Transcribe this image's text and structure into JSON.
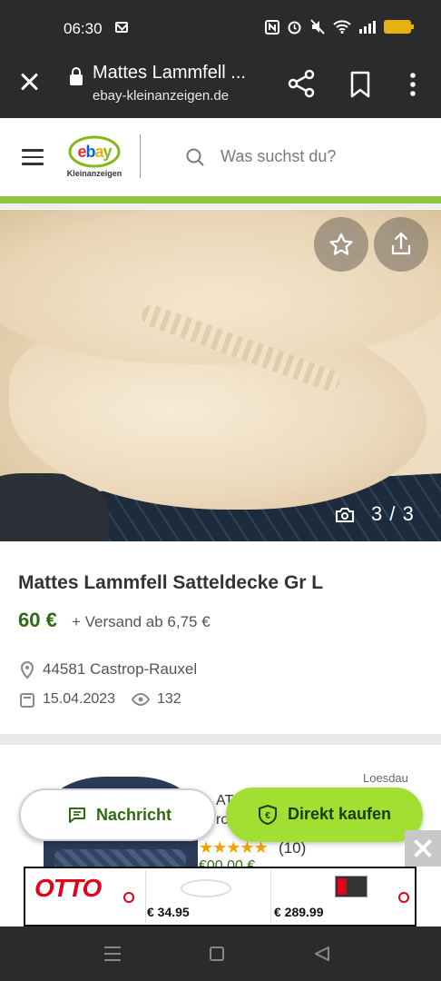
{
  "status_bar": {
    "time": "06:30"
  },
  "browser": {
    "tab_title": "Mattes Lammfell ...",
    "url": "ebay-kleinanzeigen.de"
  },
  "site_header": {
    "logo_text": "ebay",
    "logo_subtext": "Kleinanzeigen",
    "search_placeholder": "Was suchst du?"
  },
  "gallery": {
    "counter": "3 / 3"
  },
  "ad": {
    "title": "Mattes Lammfell Satteldecke Gr L",
    "price": "60 €",
    "shipping": "+ Versand ab 6,75 €",
    "location": "44581 Castrop-Rauxel",
    "date": "15.04.2023",
    "views": "132"
  },
  "promo": {
    "source": "Loesdau",
    "text_line1": "AT",
    "text_line2": "ro",
    "stars": "★★★★★",
    "rating_count": "(10)",
    "price_partial": "€00.00 €"
  },
  "actions": {
    "message_label": "Nachricht",
    "buy_label": "Direkt kaufen"
  },
  "banner": {
    "brand": "OTTO",
    "product1_price": "€ 34.95",
    "product2_price": "€ 289.99"
  },
  "colors": {
    "brand_green": "#8dc63f",
    "price_green": "#2e6b0f",
    "buy_button": "#a1e033",
    "dark_bar": "#2b2b2b",
    "otto_red": "#e2001a"
  }
}
